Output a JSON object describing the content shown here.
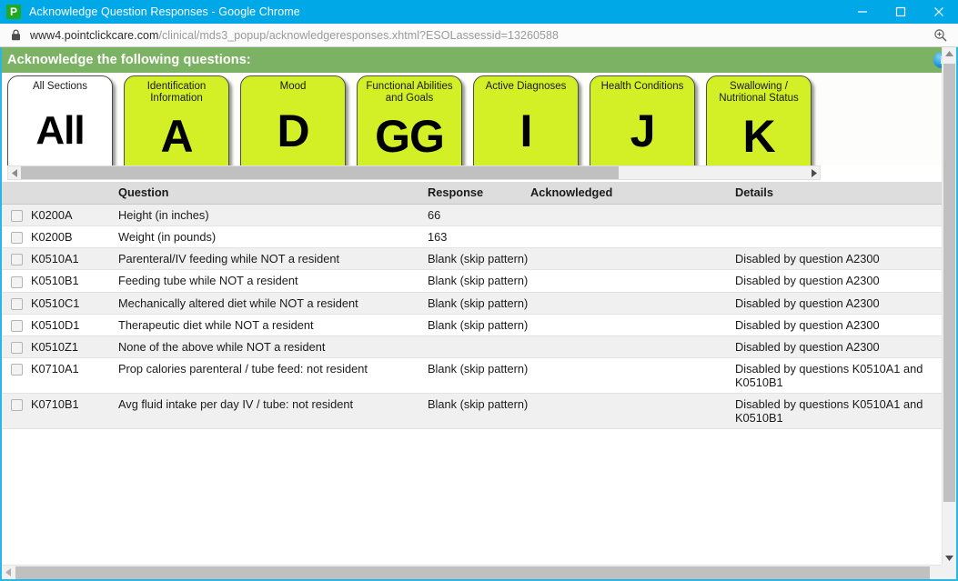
{
  "browser": {
    "tab_title": "Acknowledge Question Responses - Google Chrome",
    "favicon_letter": "P",
    "favicon_color": "#1faa1f",
    "titlebar_color": "#00a8e8",
    "minimize_label": "Minimize",
    "maximize_label": "Maximize",
    "close_label": "Close",
    "url_host": "www4.pointclickcare.com",
    "url_path": "/clinical/mds3_popup/acknowledgeresponses.xhtml?ESOLassessid=13260588",
    "zoom_icon": "zoom-in-magnifier",
    "lock_icon": "padlock-secure"
  },
  "header": {
    "title": "Acknowledge the following questions:",
    "bar_color": "#7cb263",
    "info_icon": "information-circle",
    "info_label": "i"
  },
  "sections": {
    "tile_color": "#d3f026",
    "items": [
      {
        "caption": "All Sections",
        "letter": "All",
        "selected": true
      },
      {
        "caption": "Identification Information",
        "letter": "A",
        "selected": false
      },
      {
        "caption": "Mood",
        "letter": "D",
        "selected": false
      },
      {
        "caption": "Functional Abilities and Goals",
        "letter": "GG",
        "selected": false
      },
      {
        "caption": "Active Diagnoses",
        "letter": "I",
        "selected": false
      },
      {
        "caption": "Health Conditions",
        "letter": "J",
        "selected": false
      },
      {
        "caption": "Swallowing / Nutritional Status",
        "letter": "K",
        "selected": false
      }
    ]
  },
  "table": {
    "columns": [
      "",
      "",
      "Question",
      "Response",
      "Acknowledged",
      "Details"
    ],
    "rows": [
      {
        "code": "K0200A",
        "question": "Height (in inches)",
        "response": "66",
        "acknowledged": "",
        "details": "",
        "checked": false
      },
      {
        "code": "K0200B",
        "question": "Weight (in pounds)",
        "response": "163",
        "acknowledged": "",
        "details": "",
        "checked": false
      },
      {
        "code": "K0510A1",
        "question": "Parenteral/IV feeding while NOT a resident",
        "response": "Blank (skip pattern)",
        "acknowledged": "",
        "details": "Disabled by question A2300",
        "checked": false
      },
      {
        "code": "K0510B1",
        "question": "Feeding tube while NOT a resident",
        "response": "Blank (skip pattern)",
        "acknowledged": "",
        "details": "Disabled by question A2300",
        "checked": false
      },
      {
        "code": "K0510C1",
        "question": "Mechanically altered diet while NOT a resident",
        "response": "Blank (skip pattern)",
        "acknowledged": "",
        "details": "Disabled by question A2300",
        "checked": false
      },
      {
        "code": "K0510D1",
        "question": "Therapeutic diet while NOT a resident",
        "response": "Blank (skip pattern)",
        "acknowledged": "",
        "details": "Disabled by question A2300",
        "checked": false
      },
      {
        "code": "K0510Z1",
        "question": "None of the above while NOT a resident",
        "response": "",
        "acknowledged": "",
        "details": "Disabled by question A2300",
        "checked": false
      },
      {
        "code": "K0710A1",
        "question": "Prop calories parenteral / tube feed: not resident",
        "response": "Blank (skip pattern)",
        "acknowledged": "",
        "details": "Disabled by questions K0510A1 and K0510B1",
        "checked": false
      },
      {
        "code": "K0710B1",
        "question": "Avg fluid intake per day IV / tube: not resident",
        "response": "Blank (skip pattern)",
        "acknowledged": "",
        "details": "Disabled by questions K0510A1 and K0510B1",
        "checked": false
      }
    ]
  }
}
